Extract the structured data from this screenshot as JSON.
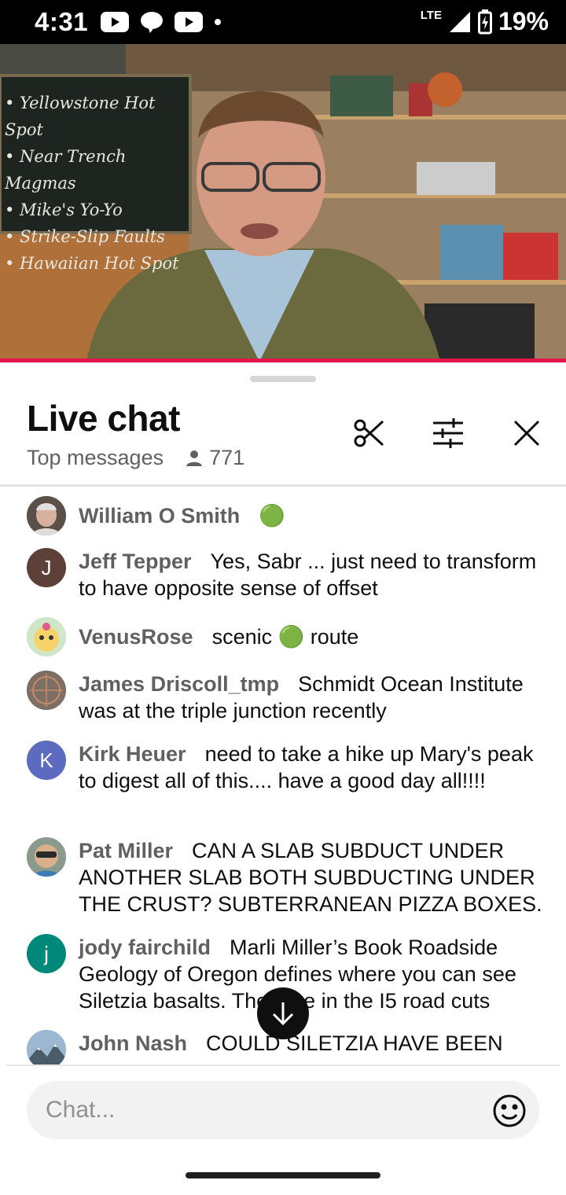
{
  "status_bar": {
    "time": "4:31",
    "network": "LTE",
    "battery_percent": "19%",
    "icons": [
      "youtube-icon",
      "chat-bubble-icon",
      "youtube-icon",
      "dot-icon",
      "signal-icon",
      "battery-icon"
    ]
  },
  "video": {
    "chalkboard_lines": [
      "• Yellowstone Hot Spot",
      "• Near Trench Magmas",
      "• Mike's Yo-Yo",
      "• Strike-Slip Faults",
      "• Hawaiian Hot Spot"
    ],
    "progress_color": "#e5154b"
  },
  "chat": {
    "title": "Live chat",
    "mode": "Top messages",
    "viewer_count": "771",
    "placeholder": "Chat...",
    "messages": [
      {
        "author": "William O Smith",
        "text": "🟢",
        "avatar_letter": "",
        "avatar_color": "#6b6b6b"
      },
      {
        "author": "Jeff Tepper",
        "text": "Yes, Sabr ... just need to transform to have opposite sense of offset",
        "avatar_letter": "J",
        "avatar_color": "#5d4037"
      },
      {
        "author": "VenusRose",
        "text": "scenic 🟢 route",
        "avatar_letter": "",
        "avatar_color": "#cfe6c8"
      },
      {
        "author": "James Driscoll_tmp",
        "text": "Schmidt Ocean Institute was at the triple junction recently",
        "avatar_letter": "",
        "avatar_color": "#7d6f63"
      },
      {
        "author": "Kirk Heuer",
        "text": "need to take a hike up Mary's peak to digest all of this.... have a good day all!!!!",
        "avatar_letter": "K",
        "avatar_color": "#5c6bc0"
      },
      {
        "author": "Pat Miller",
        "text": "CAN A SLAB SUBDUCT UNDER ANOTHER SLAB BOTH SUBDUCTING UNDER THE CRUST? SUBTERRANEAN PIZZA BOXES.",
        "avatar_letter": "",
        "avatar_color": "#8a9a8c"
      },
      {
        "author": "jody fairchild",
        "text": "Marli Miller’s Book Roadside Geology of Oregon defines where you can see Siletzia basalts. They are in the I5 road cuts",
        "avatar_letter": "j",
        "avatar_color": "#00897b"
      },
      {
        "author": "John Nash",
        "text": "COULD SILETZIA HAVE BEEN",
        "avatar_letter": "",
        "avatar_color": "#6f8fa8"
      }
    ]
  },
  "colors": {
    "accent_red": "#e5154b",
    "author_gray": "#606060",
    "live_dot_green": "#2ea043"
  }
}
